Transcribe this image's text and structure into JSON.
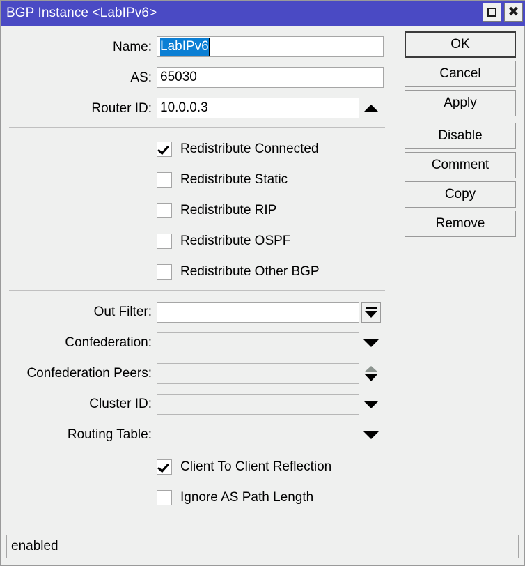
{
  "window": {
    "title": "BGP Instance <LabIPv6>",
    "controls": [
      {
        "name": "maximize-button",
        "icon": "square-icon"
      },
      {
        "name": "close-button",
        "icon": "close-icon"
      }
    ]
  },
  "form": {
    "fields": [
      {
        "label": "Name:",
        "value": "LabIPv6",
        "selected": true,
        "enabled": true,
        "adornment": "none"
      },
      {
        "label": "AS:",
        "value": "65030",
        "selected": false,
        "enabled": true,
        "adornment": "none"
      },
      {
        "label": "Router ID:",
        "value": "10.0.0.3",
        "selected": false,
        "enabled": true,
        "adornment": "up-triangle"
      },
      {
        "label": "Out Filter:",
        "value": "",
        "selected": false,
        "enabled": true,
        "adornment": "dropdown-button"
      },
      {
        "label": "Confederation:",
        "value": "",
        "selected": false,
        "enabled": false,
        "adornment": "down-triangle"
      },
      {
        "label": "Confederation Peers:",
        "value": "",
        "selected": false,
        "enabled": false,
        "adornment": "spinner"
      },
      {
        "label": "Cluster ID:",
        "value": "",
        "selected": false,
        "enabled": false,
        "adornment": "down-triangle"
      },
      {
        "label": "Routing Table:",
        "value": "",
        "selected": false,
        "enabled": false,
        "adornment": "down-triangle"
      }
    ],
    "checkboxes_top": [
      {
        "label": "Redistribute Connected",
        "checked": true
      },
      {
        "label": "Redistribute Static",
        "checked": false
      },
      {
        "label": "Redistribute RIP",
        "checked": false
      },
      {
        "label": "Redistribute OSPF",
        "checked": false
      },
      {
        "label": "Redistribute Other BGP",
        "checked": false
      }
    ],
    "checkboxes_bottom": [
      {
        "label": "Client To Client Reflection",
        "checked": true
      },
      {
        "label": "Ignore AS Path Length",
        "checked": false
      }
    ]
  },
  "buttons": [
    {
      "label": "OK",
      "default": true
    },
    {
      "label": "Cancel",
      "default": false
    },
    {
      "label": "Apply",
      "default": false
    },
    {
      "label": "Disable",
      "default": false
    },
    {
      "label": "Comment",
      "default": false
    },
    {
      "label": "Copy",
      "default": false
    },
    {
      "label": "Remove",
      "default": false
    }
  ],
  "statusbar": {
    "text": "enabled"
  },
  "colors": {
    "titlebar": "#4a4ac4",
    "window_bg": "#eff0ef",
    "selection": "#0b7fd4",
    "field_border": "#a6a6a6"
  }
}
